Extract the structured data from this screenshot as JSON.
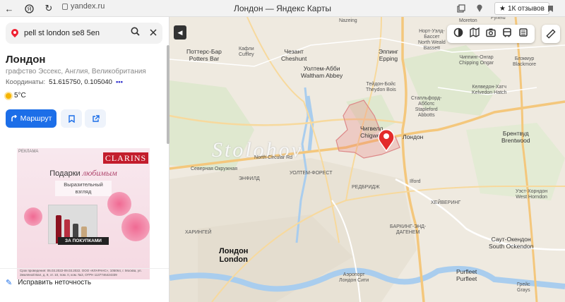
{
  "browser": {
    "url": "yandex.ru",
    "tab_title": "Лондон — Яндекс Карты",
    "reviews_badge": "1К отзывов"
  },
  "search": {
    "query": "pell st london se8 5en"
  },
  "place": {
    "title": "Лондон",
    "subtitle": "графство Эссекс, Англия, Великобритания",
    "coords_label": "Координаты:",
    "coords_value": "51.615750, 0.105040",
    "coords_more": "•••",
    "weather": "5°C"
  },
  "actions": {
    "route_label": "Маршрут"
  },
  "ad": {
    "label": "РЕКЛАМА",
    "brand": "CLARINS",
    "headline_plain": "Подарки ",
    "headline_accent": "любимым",
    "sub_text": "Выразительный взгляд",
    "cta": "ЗА ПОКУПКАМИ",
    "legal": "Срок проведения: 05.03.2022-09.03.2022. ООО «КЛАРАНС», 105064, г. Москва, ул. Земляной Вал, д. 9, эт. 10, пом. II, ком. №3, ОГРН 1137746424339"
  },
  "footer": {
    "fix_label": "Исправить неточность"
  },
  "map": {
    "watermark": "Stolohov",
    "marker_label": "Лондон",
    "labels": [
      {
        "id": "nazeing",
        "text": "Nazeing",
        "cls": ""
      },
      {
        "id": "moreton",
        "text": "Moreton",
        "cls": ""
      },
      {
        "id": "fyfield",
        "text": "Fyfield",
        "cls": ""
      },
      {
        "id": "north-weald",
        "text": "Норт-Уэлд-\nБассет\nNorth Weald\nBassett",
        "cls": ""
      },
      {
        "id": "potters-bar",
        "text": "Поттерс-Бар\nPotters Bar",
        "cls": "big"
      },
      {
        "id": "cuffley",
        "text": "Кафли\nCuffley",
        "cls": ""
      },
      {
        "id": "cheshunt",
        "text": "Чезант\nCheshunt",
        "cls": "big"
      },
      {
        "id": "epping",
        "text": "Эппинг\nEpping",
        "cls": "big"
      },
      {
        "id": "chipping-ongar",
        "text": "Чиппинг-Онгар\nChipping Ongar",
        "cls": ""
      },
      {
        "id": "blackmore",
        "text": "Блэкмур\nBlackmore",
        "cls": ""
      },
      {
        "id": "waltham-abbey",
        "text": "Уолтем-Абби\nWaltham Abbey",
        "cls": "big"
      },
      {
        "id": "theydon-bois",
        "text": "Тейдон-Бойс\nTheydon Bois",
        "cls": ""
      },
      {
        "id": "kelvedon-hatch",
        "text": "Келведон-Хатч\nKelvedon Hatch",
        "cls": ""
      },
      {
        "id": "stapleford-abbotts",
        "text": "Стапльфорд-\nАбботс\nStapleford\nAbbotts",
        "cls": ""
      },
      {
        "id": "chigwell",
        "text": "Чигвелл\nChigwell",
        "cls": "big"
      },
      {
        "id": "london-marker-area",
        "text": "Лондон",
        "cls": "big"
      },
      {
        "id": "brentwood",
        "text": "Брентвуд\nBrentwood",
        "cls": "big"
      },
      {
        "id": "west-horndon",
        "text": "Уэст-Хорндон\nWest Horndon",
        "cls": ""
      },
      {
        "id": "walthamstow",
        "text": "УОЛТЕМ-ФОРЕСТ",
        "cls": ""
      },
      {
        "id": "redbridge",
        "text": "РЕДБРИДЖ",
        "cls": ""
      },
      {
        "id": "barking",
        "text": "БАРКИНГ-ЭНД-\nДАГЕНЕМ",
        "cls": ""
      },
      {
        "id": "havering",
        "text": "ХЕЙВЕРИНГ",
        "cls": ""
      },
      {
        "id": "london-city",
        "text": "Лондон\nLondon",
        "cls": "city"
      },
      {
        "id": "south-ockendon",
        "text": "Саут-Окендон\nSouth Ockendon",
        "cls": "big"
      },
      {
        "id": "london-city-airport",
        "text": "Аэропорт\nЛондон Сити",
        "cls": ""
      },
      {
        "id": "purfleet",
        "text": "Purfleet\nPurfleet",
        "cls": "big"
      },
      {
        "id": "grays",
        "text": "Грейс\nGrays",
        "cls": ""
      },
      {
        "id": "karing",
        "text": "ХАРИНГЕЙ",
        "cls": ""
      },
      {
        "id": "enfield",
        "text": "ЭНФИЛД",
        "cls": ""
      },
      {
        "id": "m25-road",
        "text": "Северная Окружная",
        "cls": ""
      },
      {
        "id": "north-circular",
        "text": "North Circular Rd",
        "cls": ""
      },
      {
        "id": "a406",
        "text": "Ilford",
        "cls": ""
      }
    ]
  }
}
